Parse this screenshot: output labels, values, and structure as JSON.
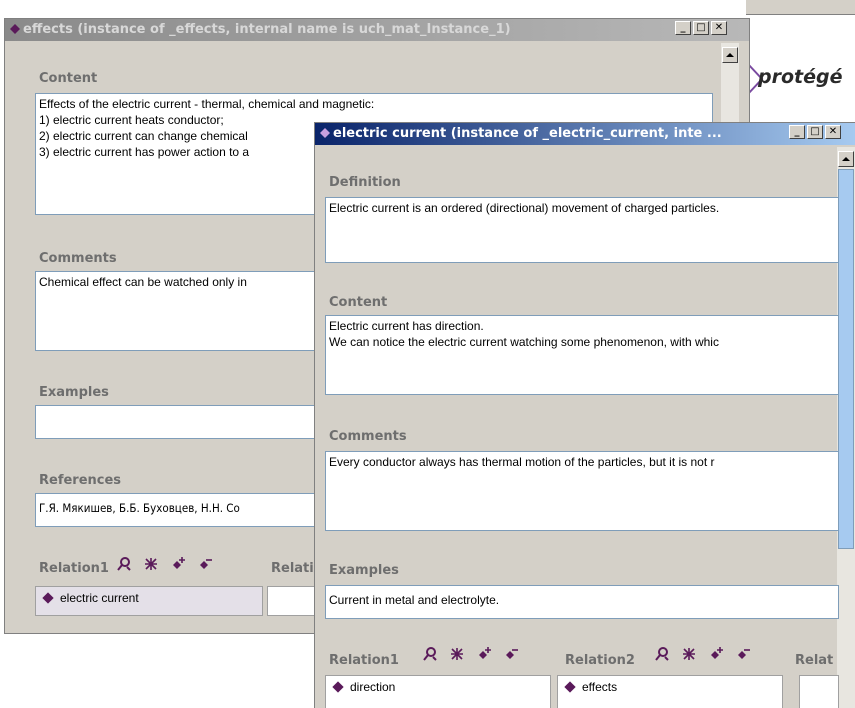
{
  "window1": {
    "title": "effects  (instance of _effects, internal name is uch_mat_Instance_1)",
    "content_label": "Content",
    "content_lines": [
      "Effects of the electric current - thermal, chemical and magnetic:",
      "1) electric current heats conductor;",
      "2) electric current can change chemical",
      "3) electric current has power action to a"
    ],
    "comments_label": "Comments",
    "comments_text": "Chemical effect can be watched only in",
    "examples_label": "Examples",
    "examples_text": "",
    "references_label": "References",
    "references_text": "Г.Я. Мякишев, Б.Б. Буховцев, Н.Н. Со",
    "relation1_label": "Relation1",
    "relation1_item": "electric current",
    "relation2_label": "Relati"
  },
  "window2": {
    "title": "electric current  (instance of _electric_current, inte ...",
    "definition_label": "Definition",
    "definition_text": "Electric current is an ordered (directional) movement of charged particles.",
    "content_label": "Content",
    "content_lines": [
      "Electric current has direction.",
      "We can notice the electric current watching some phenomenon, with whic"
    ],
    "comments_label": "Comments",
    "comments_text": "Every  conductor always has  thermal motion of the particles, but it is not r",
    "examples_label": "Examples",
    "examples_text": "Current in metal and electrolyte.",
    "relation1_label": "Relation1",
    "relation1_item": "direction",
    "relation2_label": "Relation2",
    "relation2_item": "effects",
    "relation3_label": "Relat"
  },
  "background": {
    "logo_text": "protégé"
  },
  "titlebar_buttons": {
    "minimize": "_",
    "maximize": "□",
    "close": "✕"
  },
  "icons": [
    "instance-icon",
    "view-icon",
    "create-icon",
    "add-icon",
    "remove-icon"
  ],
  "colors": {
    "accent": "#5a1a5a",
    "active_title": "#0a246a",
    "inactive_title": "#8a8a8a"
  }
}
